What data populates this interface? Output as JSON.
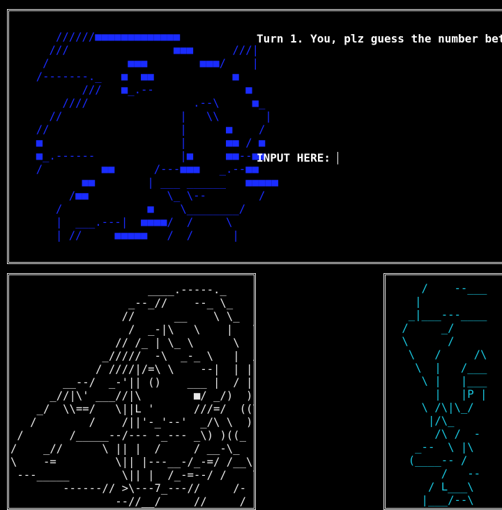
{
  "game": {
    "turn_message": "Turn 1. You, plz guess the number betwe",
    "input_label": "INPUT HERE:",
    "input_value": ""
  },
  "art": {
    "blue": "     //////■■■■■■■■■■■■■             \n    ///                ■■■      ///|\n   /            ■■■        ■■■/    |\n  /-------._   ■  ■■            ■\n         ///   ■_.--              ■\n      ////                .--\\     ■_\n    //                  |   \\\\       |\n  //                    |      ■    /\n  ■                     |      ■■ / ■\n  ■_.------             |■     ■■--■■\n  /         ■■      /---■■■   _.--■■\n         ■■        | ___ ______   ■■■■■\n       /■■            \\_ \\--        /\n     /             ■    \\________/\n     |  ___.---|  ■■■■/  /     \\\n     | //     ■■■■■   /  /      |",
    "white": "                     ____.-----._\n                  _--_//    --_ \\_\n                 //      __    \\ \\_\n                  /  _-|\\   \\    |   \\\n                // /_ | \\_ \\      \\  |\n              _/////  -\\  _-_ \\   |  /\n             / ////|/=\\ \\    --|  | |\n        __--/  _-'|| ()    ___ |  / |\n      _//|\\' ___//|\\        ■/ _/)  )\n    _/  \\\\==/   \\||L '      ///=/  ((7\n   /        /    /||'-_'--'  _/\\ \\  ))\n /       /_____--/--- -_--- _\\) )((_\n/    _//      \\ || |  /     / __-\\_\n\\    -=         \\|| |---__-/_-=/ /__\\\n ---_____        \\|| |  /_-=--/ /    \\\n        ------// >\\---7_---//     /- |\n                --//__/     //     /  |",
    "cyan": "    /    --___\n   |\n  _|___---____\n /     _/\n \\      /\n  \\   /     /\\\n   \\  |   /___\n    \\ |   |___\n      |   |P |\n    \\ /\\|\\_/\n     |/\\_\n      /\\ /  -\n   _--  \\ |\\\n  (____-- /\n       /   --\n     / L___\\\n    |___/--\\"
  }
}
